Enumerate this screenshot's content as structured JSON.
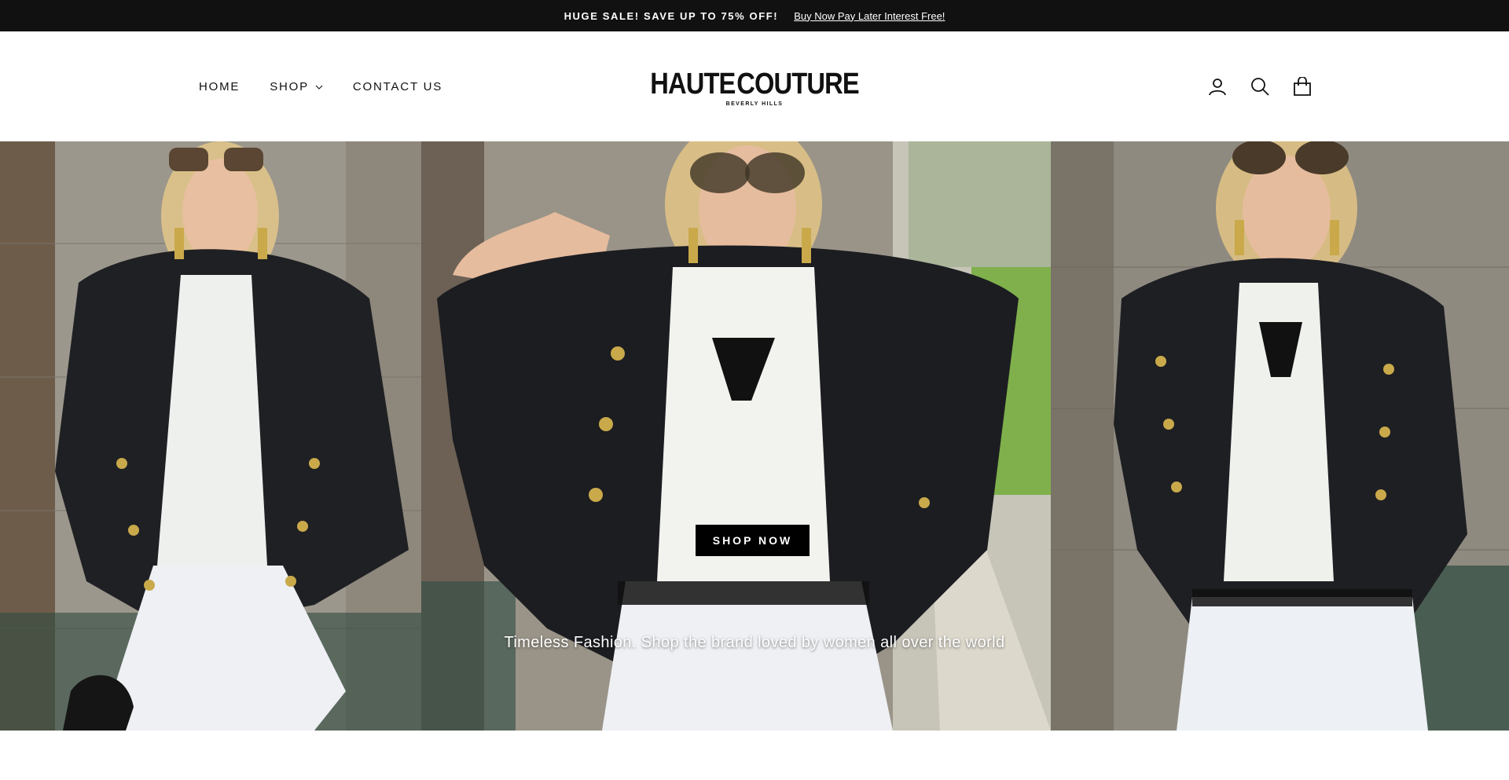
{
  "announcement": {
    "sale_text": "HUGE SALE! SAVE UP TO 75% OFF!",
    "link_text": "Buy Now Pay Later Interest Free!"
  },
  "nav": {
    "items": [
      {
        "label": "HOME"
      },
      {
        "label": "SHOP",
        "has_dropdown": true
      },
      {
        "label": "CONTACT US"
      }
    ]
  },
  "logo": {
    "left": "HAUTE",
    "right": "COUTURE",
    "sub": "BEVERLY HILLS",
    "heart_color": "#e04a8a"
  },
  "header_icons": [
    "user-icon",
    "search-icon",
    "cart-icon"
  ],
  "hero": {
    "tagline": "Timeless Fashion. Shop the brand loved by women all over the world",
    "button_label": "SHOP NOW"
  },
  "colors": {
    "announcement_bg": "#111111",
    "button_bg": "#000000",
    "accent": "#e04a8a"
  }
}
